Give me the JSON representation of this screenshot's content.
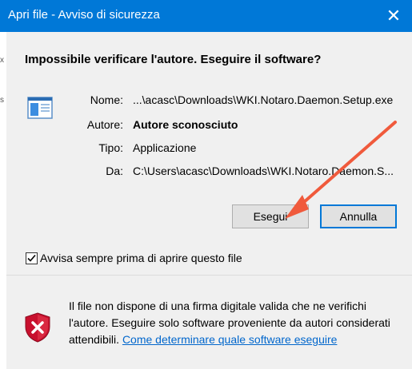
{
  "window": {
    "title": "Apri file - Avviso di sicurezza",
    "close_glyph": "✕"
  },
  "headline": "Impossibile verificare l'autore. Eseguire il software?",
  "fields": [
    {
      "label": "Nome:",
      "value": "...\\acasc\\Downloads\\WKI.Notaro.Daemon.Setup.exe",
      "bold": false
    },
    {
      "label": "Autore:",
      "value": "Autore sconosciuto",
      "bold": true
    },
    {
      "label": "Tipo:",
      "value": "Applicazione",
      "bold": false
    },
    {
      "label": "Da:",
      "value": "C:\\Users\\acasc\\Downloads\\WKI.Notaro.Daemon.S...",
      "bold": false
    }
  ],
  "buttons": {
    "run": "Esegui",
    "cancel": "Annulla"
  },
  "checkbox": {
    "label": "Avvisa sempre prima di aprire questo file",
    "checked": true
  },
  "info": {
    "text": "Il file non dispone di una firma digitale valida che ne verifichi l'autore. Eseguire solo software proveniente da autori considerati attendibili. ",
    "link": "Come determinare quale software eseguire"
  },
  "left_edge_marks": [
    "x",
    "s"
  ],
  "icons": {
    "app": "application-window-icon",
    "shield": "security-shield-icon",
    "annotation": "red-arrow-annotation"
  },
  "colors": {
    "titlebar": "#0078d7",
    "link": "#0066cc",
    "arrow": "#f05a3c",
    "shield": "#c8102e"
  }
}
